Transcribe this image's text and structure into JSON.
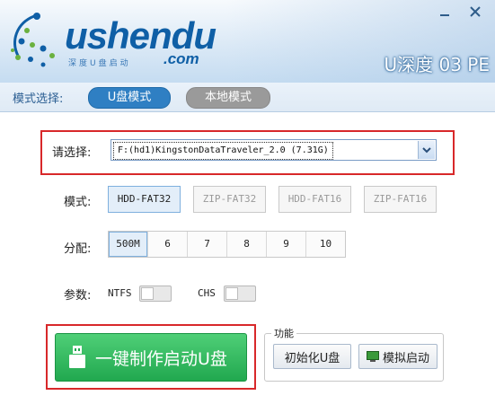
{
  "window": {
    "brand": "ushendu",
    "brand_domain": ".com",
    "tagline": "深度U盘启动",
    "product_title": "U深度 03 PE"
  },
  "mode_bar": {
    "label": "模式选择:",
    "tabs": [
      {
        "label": "U盘模式",
        "active": true
      },
      {
        "label": "本地模式",
        "active": false
      }
    ]
  },
  "drive": {
    "label": "请选择:",
    "selected": "F:(hd1)KingstonDataTraveler_2.0 (7.31G)"
  },
  "mode": {
    "label": "模式:",
    "options": [
      {
        "label": "HDD-FAT32",
        "selected": true
      },
      {
        "label": "ZIP-FAT32",
        "selected": false
      },
      {
        "label": "HDD-FAT16",
        "selected": false
      },
      {
        "label": "ZIP-FAT16",
        "selected": false
      }
    ]
  },
  "allocation": {
    "label": "分配:",
    "options": [
      "500M",
      "6",
      "7",
      "8",
      "9",
      "10"
    ],
    "selected": "500M"
  },
  "params": {
    "label": "参数:",
    "ntfs_label": "NTFS",
    "ntfs_on": false,
    "chs_label": "CHS",
    "chs_on": false
  },
  "actions": {
    "make_button": "一键制作启动U盘",
    "group_title": "功能",
    "init_button": "初始化U盘",
    "simulate_button": "模拟启动"
  },
  "colors": {
    "brand_blue": "#0f5fa6",
    "accent_blue": "#2f7fc3",
    "highlight_red": "#d8282a",
    "primary_green": "#21a84f"
  }
}
